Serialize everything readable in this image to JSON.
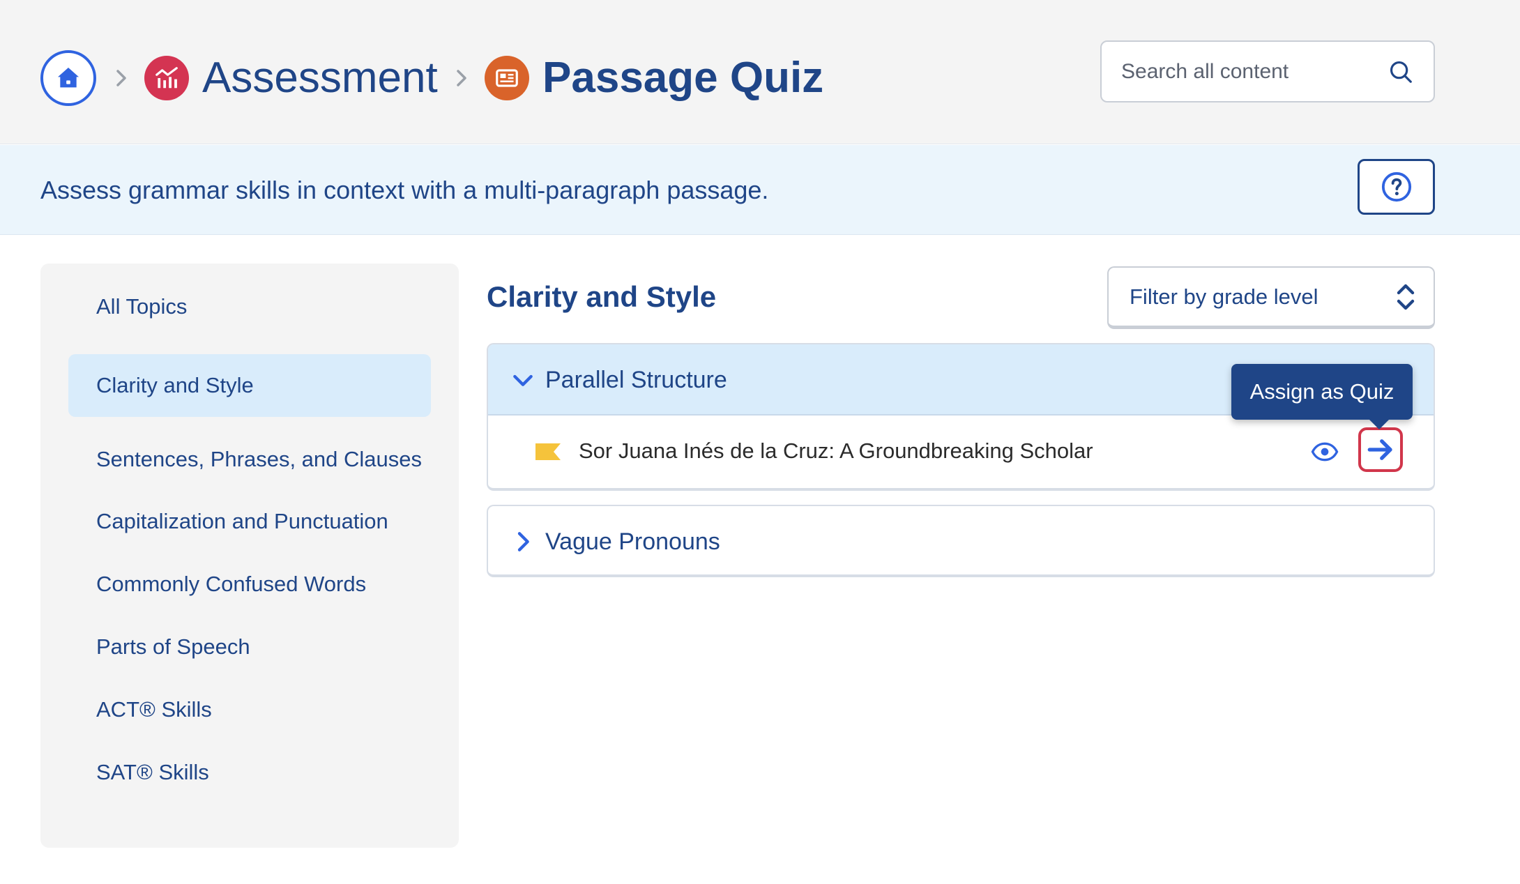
{
  "breadcrumb": {
    "home_icon": "home-icon",
    "items": [
      {
        "label": "Assessment",
        "icon": "chart-icon",
        "color": "#d43452"
      },
      {
        "label": "Passage Quiz",
        "icon": "newspaper-icon",
        "color": "#d9632a"
      }
    ]
  },
  "search": {
    "placeholder": "Search all content",
    "value": ""
  },
  "description": "Assess grammar skills in context with a multi-paragraph passage.",
  "help": {
    "icon": "question-icon"
  },
  "sidebar": {
    "items": [
      {
        "label": "All Topics",
        "active": false
      },
      {
        "label": "Clarity and Style",
        "active": true
      },
      {
        "label": "Sentences, Phrases, and Clauses",
        "active": false
      },
      {
        "label": "Capitalization and Punctuation",
        "active": false
      },
      {
        "label": "Commonly Confused Words",
        "active": false
      },
      {
        "label": "Parts of Speech",
        "active": false
      },
      {
        "label": "ACT® Skills",
        "active": false
      },
      {
        "label": "SAT® Skills",
        "active": false
      }
    ]
  },
  "main": {
    "title": "Clarity and Style",
    "filter_label": "Filter by grade level",
    "groups": [
      {
        "title": "Parallel Structure",
        "expanded": true,
        "activities": [
          {
            "title": "Sor Juana Inés de la Cruz: A Groundbreaking Scholar",
            "flag_color": "#f5c33b"
          }
        ]
      },
      {
        "title": "Vague Pronouns",
        "expanded": false,
        "activities": []
      }
    ],
    "tooltip": "Assign as Quiz"
  },
  "colors": {
    "primary": "#1f4587",
    "link": "#2f63e0",
    "highlight": "#d9ecfb",
    "alert_outline": "#d1364b"
  }
}
